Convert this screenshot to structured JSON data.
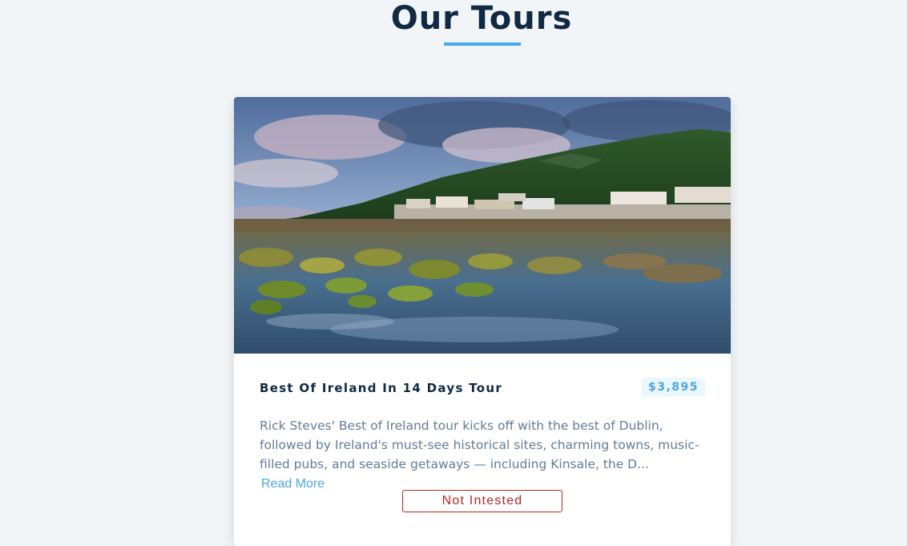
{
  "header": {
    "title": "Our Tours"
  },
  "tour": {
    "name": "Best Of Ireland In 14 Days Tour",
    "price": "$3,895",
    "info": "Rick Steves' Best of Ireland tour kicks off with the best of Dublin, followed by Ireland's must-see historical sites, charming towns, music-filled pubs, and seaside getaways — including Kinsale, the D...",
    "read_more_label": "Read More",
    "dismiss_label": "Not Intested"
  },
  "colors": {
    "background": "#f1f5f8",
    "accent": "#49a6e9",
    "title": "#102a42",
    "danger": "#bb2525",
    "text": "#617d98"
  }
}
